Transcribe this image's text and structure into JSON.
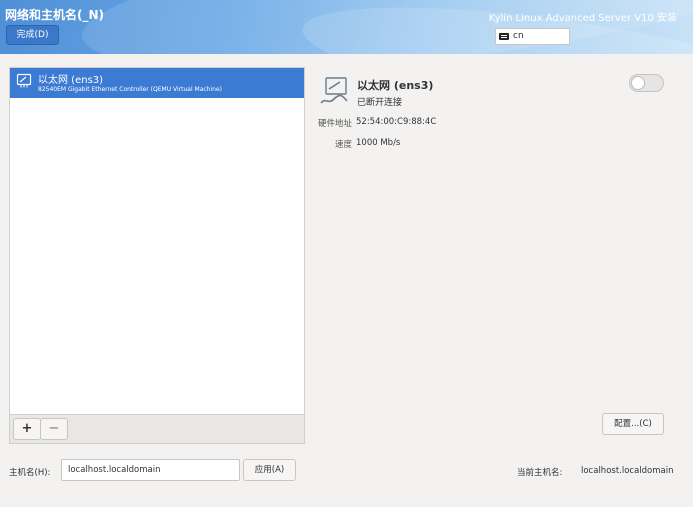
{
  "header": {
    "title": "网络和主机名(_N)",
    "done_label": "完成(D)",
    "product": "Kylin Linux Advanced Server V10 安装",
    "keyboard_layout": "cn"
  },
  "devices": [
    {
      "name": "以太网 (ens3)",
      "description": "82540EM Gigabit Ethernet Controller (QEMU Virtual Machine)",
      "selected": true
    }
  ],
  "toolbar": {
    "add_label": "+",
    "remove_label": "−"
  },
  "detail": {
    "name": "以太网 (ens3)",
    "status": "已断开连接",
    "toggle_on": false,
    "properties": [
      {
        "label": "硬件地址",
        "value": "52:54:00:C9:88:4C"
      },
      {
        "label": "速度",
        "value": "1000 Mb/s"
      }
    ],
    "configure_label": "配置...(C)"
  },
  "hostname": {
    "label": "主机名(H):",
    "value": "localhost.localdomain",
    "apply_label": "应用(A)",
    "current_label": "当前主机名:",
    "current_value": "localhost.localdomain"
  },
  "colors": {
    "accent": "#3c7bd4",
    "header_start": "#4f8fd6",
    "header_end": "#c9e2f7"
  }
}
